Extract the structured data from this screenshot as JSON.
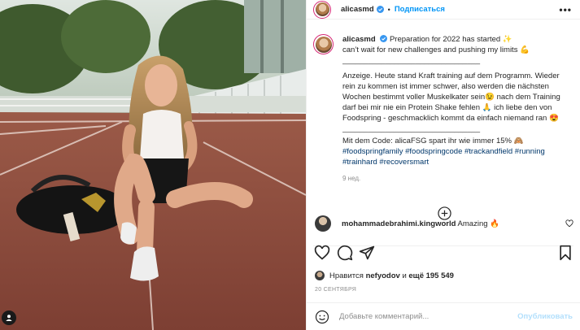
{
  "header": {
    "username": "alicasmd",
    "separator": "•",
    "follow_label": "Подписаться",
    "more_icon": "more-horizontal-icon"
  },
  "caption": {
    "username": "alicasmd",
    "line1": "Preparation for 2022 has started ✨",
    "line2": "can’t wait for new challenges and pushing my limits 💪",
    "divider": "________________________________",
    "p2": "Anzeige. Heute stand Kraft training auf dem Programm. Wieder rein zu kommen ist immer schwer, also werden die nächsten Wochen bestimmt voller Muskelkater sein😉 nach dem Training darf bei mir nie ein Protein Shake fehlen 🙏 ich liebe den von Foodspring - geschmacklich kommt da einfach niemand ran 😍",
    "divider2": "________________________________",
    "p3": "Mit dem Code: alicaFSG spart ihr wie immer 15% 🙈",
    "hashtags": [
      "#foodspringfamily",
      "#foodspringcode",
      "#trackandfield",
      "#running",
      "#trainhard",
      "#recoversmart"
    ],
    "time_ago": "9 нед."
  },
  "comment": {
    "username": "mohammadebrahimi.kingworld",
    "text": "Amazing 🔥"
  },
  "likes": {
    "prefix": "Нравится",
    "liker": "nefyodov",
    "conj": "и",
    "others": "ещё 195 549"
  },
  "date": "20 СЕНТЯБРЯ",
  "add_comment": {
    "placeholder": "Добавьте комментарий...",
    "publish_label": "Опубликовать"
  },
  "colors": {
    "accent": "#0095f6",
    "publish_disabled": "#b2dffc",
    "hashtag": "#00376b",
    "muted": "#8e8e8e"
  }
}
